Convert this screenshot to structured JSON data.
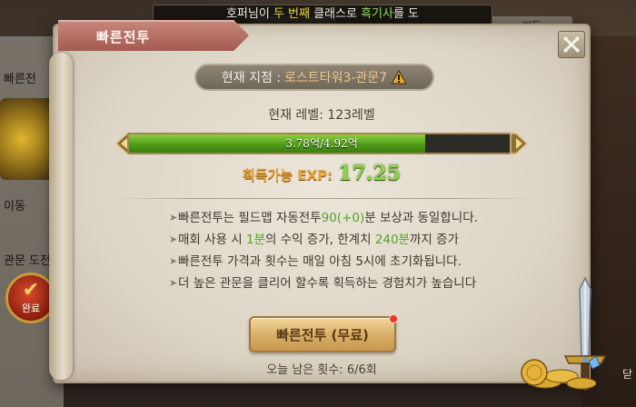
{
  "ticker": {
    "part1": "호퍼님이 ",
    "part2": "두 번째",
    "part3": " 클래스로 ",
    "part4": "흑기사",
    "part5": "를 도"
  },
  "background": {
    "left_label_top": "빠른전",
    "left_label_move": "이동",
    "left_label_stage": "관문 도전",
    "badge_label": "완료",
    "tab_left": "이동",
    "tab_right": "이동",
    "right_label": "닫"
  },
  "dialog": {
    "title": "빠른전투",
    "location_label": "현재 지점 : ",
    "location_value": "로스트타워3-관문7",
    "current_level": "현재 레벨: 123레벨",
    "exp_text": "3.78억/4.92억",
    "exp_progress": 0.768,
    "exp_gain_label": "획득가능 EXP:",
    "exp_gain_value": "17.25",
    "info": [
      {
        "a": "빠른전투는 필드맵 자동전투",
        "h": "90(+0)",
        "b": "분 보상과 동일합니다."
      },
      {
        "a": "매회 사용 시 ",
        "h": "1분",
        "b": "의 수익 증가, 한계치 ",
        "h2": "240분",
        "c": "까지 증가"
      },
      {
        "a": "빠른전투 가격과 횟수는 매일 아침 5시에 초기화됩니다.",
        "h": "",
        "b": ""
      },
      {
        "a": "더 높은 관문을 클리어 할수록 획득하는 경험치가 높습니다",
        "h": "",
        "b": ""
      }
    ],
    "button_label": "빠른전투 (무료)",
    "remaining_label": "오늘 남은 횟수:",
    "remaining_value": "6/6회"
  },
  "colors": {
    "exp_fill": "#4f9c18",
    "exp_gain_value": "#8fd34a",
    "highlight": "#58a12a",
    "ribbon": "#a45a50",
    "button": "#d8b06a"
  },
  "icons": [
    "close-icon",
    "warning-icon",
    "bullet-arrow-icon",
    "sword-icon",
    "coins-icon",
    "check-icon"
  ]
}
